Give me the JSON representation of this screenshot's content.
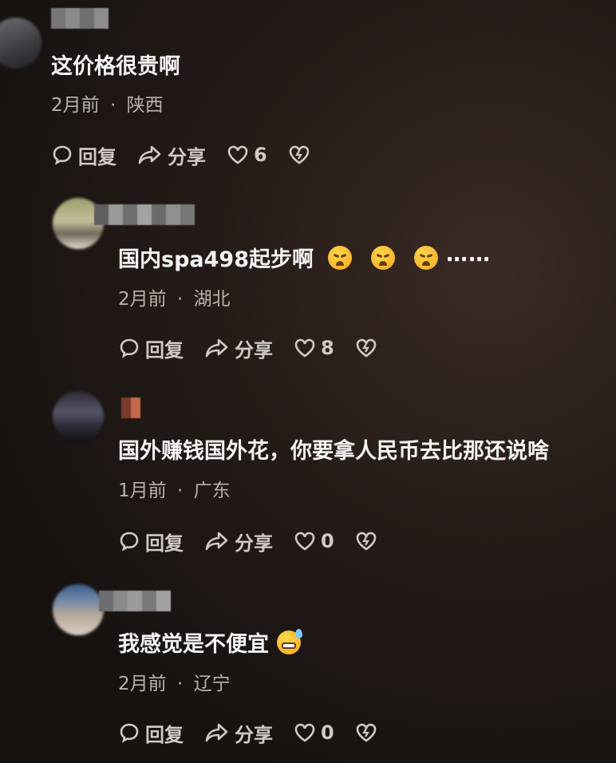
{
  "comments": [
    {
      "text": "这价格很贵啊",
      "time": "2月前",
      "location": "陕西",
      "reply_label": "回复",
      "share_label": "分享",
      "likes": "6"
    },
    {
      "text": "国内spa498起步啊",
      "emoji_trail": "⋯⋯",
      "time": "2月前",
      "location": "湖北",
      "reply_label": "回复",
      "share_label": "分享",
      "likes": "8"
    },
    {
      "text": "国外赚钱国外花，你要拿人民币去比那还说啥",
      "time": "1月前",
      "location": "广东",
      "reply_label": "回复",
      "share_label": "分享",
      "likes": "0"
    },
    {
      "text": "我感觉是不便宜",
      "time": "2月前",
      "location": "辽宁",
      "reply_label": "回复",
      "share_label": "分享",
      "likes": "0"
    }
  ],
  "separator": "·",
  "icons": {
    "reply": "speech-bubble-icon",
    "share": "share-arrow-icon",
    "like": "heart-icon",
    "dislike": "broken-heart-icon"
  }
}
